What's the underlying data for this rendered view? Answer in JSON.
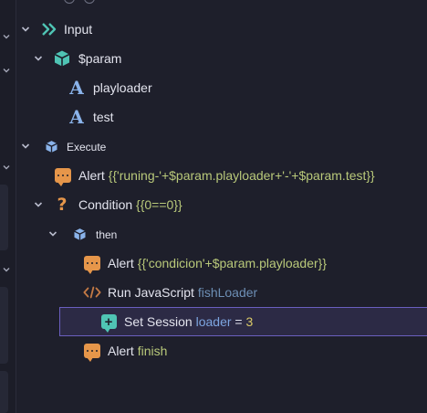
{
  "tree": {
    "input": {
      "label": "Input",
      "icon": "double-chevron-icon"
    },
    "param": {
      "label": "$param",
      "icon": "cube-icon"
    },
    "playloader": {
      "label": "playloader",
      "icon": "text-type-icon"
    },
    "test": {
      "label": "test",
      "icon": "text-type-icon"
    },
    "execute": {
      "label": "Execute",
      "icon": "cube-icon"
    },
    "alert1": {
      "label": "Alert",
      "value": "{{'runing-'+$param.playloader+'-'+$param.test}}",
      "icon": "message-icon"
    },
    "condition": {
      "label": "Condition",
      "value": "{{0==0}}",
      "icon": "question-icon"
    },
    "then": {
      "label": "then",
      "icon": "cube-icon"
    },
    "alert2": {
      "label": "Alert",
      "value": "{{'condicion'+$param.playloader}}",
      "icon": "message-icon"
    },
    "run_js": {
      "label": "Run JavaScript",
      "value": "fishLoader",
      "icon": "code-icon"
    },
    "set_session": {
      "label": "Set Session",
      "key": "loader",
      "op": "=",
      "value": "3",
      "icon": "message-plus-icon"
    },
    "alert3": {
      "label": "Alert",
      "value": "finish",
      "icon": "message-icon"
    }
  },
  "colors": {
    "background": "#1e1f2b",
    "accent_teal": "#4fc4b4",
    "alert_orange": "#e6964a",
    "type_blue": "#8ab3ea",
    "value_gold": "#d9c867",
    "selection": "#2c2a45",
    "selection_border": "#6a5fbf"
  }
}
